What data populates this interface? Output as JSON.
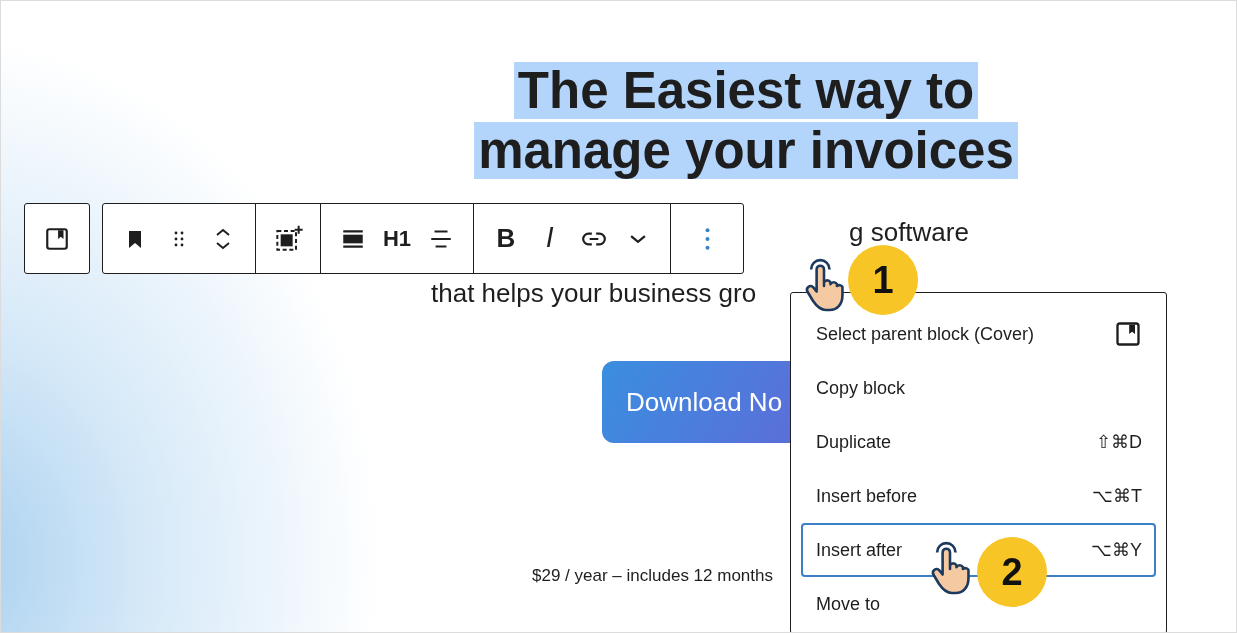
{
  "heading": {
    "lines": [
      {
        "text": "The Easiest way to",
        "highlighted": true
      },
      {
        "text": "manage your invoices",
        "highlighted": true
      }
    ]
  },
  "subtitle": {
    "line_1": "g software",
    "line_2": "that helps your business gro"
  },
  "download_button": "Download No",
  "price_note": "$29 / year – includes 12 months",
  "toolbar": {
    "heading_level": "H1",
    "bold_label": "B",
    "italic_label": "I",
    "more_pressed": true
  },
  "menu": {
    "items": [
      {
        "kind": "parent",
        "label": "Select parent block (Cover)",
        "selected": false
      },
      {
        "kind": "action",
        "label": "Copy block",
        "selected": false
      },
      {
        "kind": "action",
        "label": "Duplicate",
        "shortcut": "⇧⌘D",
        "selected": false
      },
      {
        "kind": "action",
        "label": "Insert before",
        "shortcut": "⌥⌘T",
        "selected": false
      },
      {
        "kind": "action",
        "label": "Insert after",
        "shortcut": "⌥⌘Y",
        "selected": true
      },
      {
        "kind": "action",
        "label": "Move to",
        "selected": false
      }
    ]
  },
  "steps": [
    "1",
    "2"
  ]
}
